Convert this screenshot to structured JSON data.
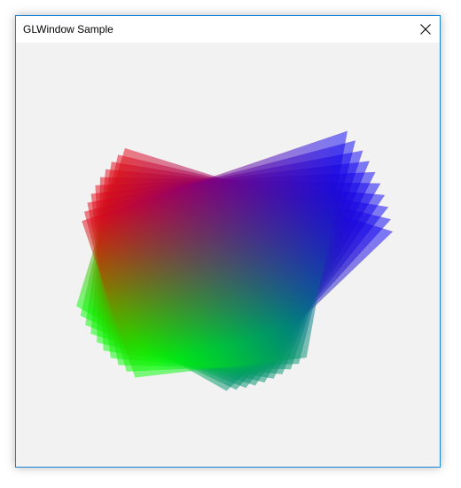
{
  "window": {
    "title": "GLWindow Sample",
    "close_icon": "close-icon"
  },
  "canvas": {
    "background": "#f2f2f2",
    "triangle_count": 10,
    "rotation_step_deg": 4,
    "vertex_colors": [
      "#ff0000",
      "#00ff00",
      "#0000ff"
    ],
    "triangle_opacity": 0.5
  }
}
